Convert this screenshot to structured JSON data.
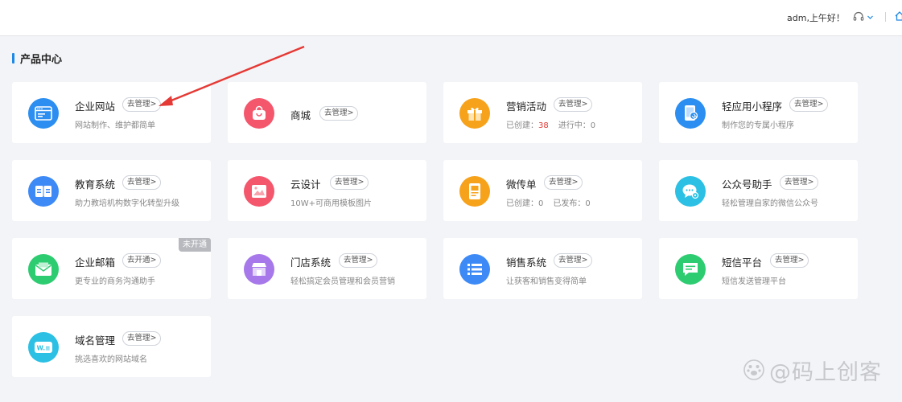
{
  "header": {
    "greeting": "adm,上午好！"
  },
  "section": {
    "title": "产品中心"
  },
  "cards": [
    {
      "title": "企业网站",
      "button": "去管理>",
      "desc": "网站制作、维护都简单",
      "icon": "website-icon",
      "color": "#2b8ef0"
    },
    {
      "title": "商城",
      "button": "去管理>",
      "desc": "",
      "icon": "shopping-bag-icon",
      "color": "#f4566c"
    },
    {
      "title": "营销活动",
      "button": "去管理>",
      "desc_parts": [
        "已创建：",
        "38",
        "进行中：0"
      ],
      "icon": "gift-icon",
      "color": "#f7a21b"
    },
    {
      "title": "轻应用小程序",
      "button": "去管理>",
      "desc": "制作您的专属小程序",
      "icon": "mini-program-icon",
      "color": "#2b8ef0"
    },
    {
      "title": "教育系统",
      "button": "去管理>",
      "desc": "助力教培机构数字化转型升级",
      "icon": "book-icon",
      "color": "#3d8af7"
    },
    {
      "title": "云设计",
      "button": "去管理>",
      "desc": "10W+可商用模板图片",
      "icon": "image-icon",
      "color": "#f4566c"
    },
    {
      "title": "微传单",
      "button": "去管理>",
      "desc_parts": [
        "已创建：0",
        "已发布：0"
      ],
      "icon": "flyer-icon",
      "color": "#f7a21b"
    },
    {
      "title": "公众号助手",
      "button": "去管理>",
      "desc": "轻松管理自家的微信公众号",
      "icon": "wechat-icon",
      "color": "#2bc0e4"
    },
    {
      "title": "企业邮箱",
      "button": "去开通>",
      "desc": "更专业的商务沟通助手",
      "icon": "mail-icon",
      "color": "#2ecc71",
      "badge": "未开通"
    },
    {
      "title": "门店系统",
      "button": "去管理>",
      "desc": "轻松搞定会员管理和会员营销",
      "icon": "store-icon",
      "color": "#a678ea"
    },
    {
      "title": "销售系统",
      "button": "去管理>",
      "desc": "让获客和销售变得简单",
      "icon": "list-icon",
      "color": "#3d8af7"
    },
    {
      "title": "短信平台",
      "button": "去管理>",
      "desc": "短信发送管理平台",
      "icon": "sms-icon",
      "color": "#2ecc71"
    },
    {
      "title": "域名管理",
      "button": "去管理>",
      "desc": "挑选喜欢的网站域名",
      "icon": "domain-icon",
      "color": "#2bc0e4"
    }
  ],
  "watermark": {
    "text": "@码上创客"
  }
}
